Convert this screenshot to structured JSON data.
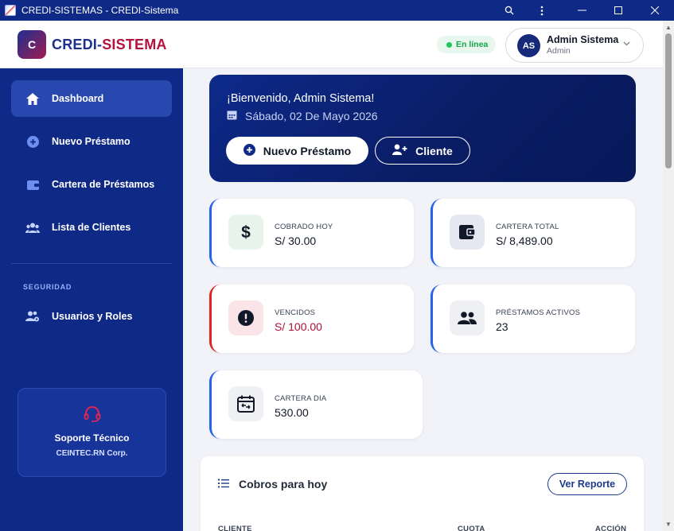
{
  "window": {
    "title": "CREDI-SISTEMAS - CREDI-Sistema",
    "controls": [
      "search-icon",
      "more-icon",
      "minimize-icon",
      "maximize-icon",
      "close-icon"
    ]
  },
  "header": {
    "logo_letter": "C",
    "brand_part1": "CREDI-",
    "brand_part2": "SISTEMA",
    "status": "En línea",
    "user": {
      "initials": "AS",
      "name": "Admin Sistema",
      "role": "Admin"
    }
  },
  "sidebar": {
    "items": [
      {
        "label": "Dashboard",
        "icon": "home-icon",
        "active": true
      },
      {
        "label": "Nuevo Préstamo",
        "icon": "plus-circle-icon"
      },
      {
        "label": "Cartera de Préstamos",
        "icon": "wallet-icon"
      },
      {
        "label": "Lista de Clientes",
        "icon": "users-icon"
      }
    ],
    "section_label": "SEGURIDAD",
    "security_items": [
      {
        "label": "Usuarios y Roles",
        "icon": "users-gear-icon"
      }
    ],
    "support": {
      "title": "Soporte Técnico",
      "subtitle": "CEINTEC.RN Corp.",
      "icon": "headset-icon"
    }
  },
  "banner": {
    "greeting": "¡Bienvenido, Admin Sistema!",
    "date": "Sábado, 02 De Mayo 2026",
    "primary_button": "Nuevo Préstamo",
    "secondary_button": "Cliente"
  },
  "stats": [
    {
      "label": "COBRADO HOY",
      "value": "S/ 30.00",
      "icon": "dollar-icon"
    },
    {
      "label": "CARTERA TOTAL",
      "value": "S/ 8,489.00",
      "icon": "wallet-icon"
    },
    {
      "label": "VENCIDOS",
      "value": "S/ 100.00",
      "icon": "alert-icon"
    },
    {
      "label": "PRÉSTAMOS ACTIVOS",
      "value": "23",
      "icon": "users-icon"
    },
    {
      "label": "CARTERA DIA",
      "value": "530.00",
      "icon": "calendar-icon"
    }
  ],
  "cobros": {
    "title": "Cobros para hoy",
    "report_button": "Ver Reporte",
    "columns": [
      "CLIENTE",
      "CUOTA",
      "ACCIÓN"
    ]
  },
  "colors": {
    "primary": "#0f2a86",
    "accent_red": "#b3123f",
    "success": "#22c55e",
    "card_border_blue": "#2563eb",
    "card_border_red": "#dc2626"
  }
}
